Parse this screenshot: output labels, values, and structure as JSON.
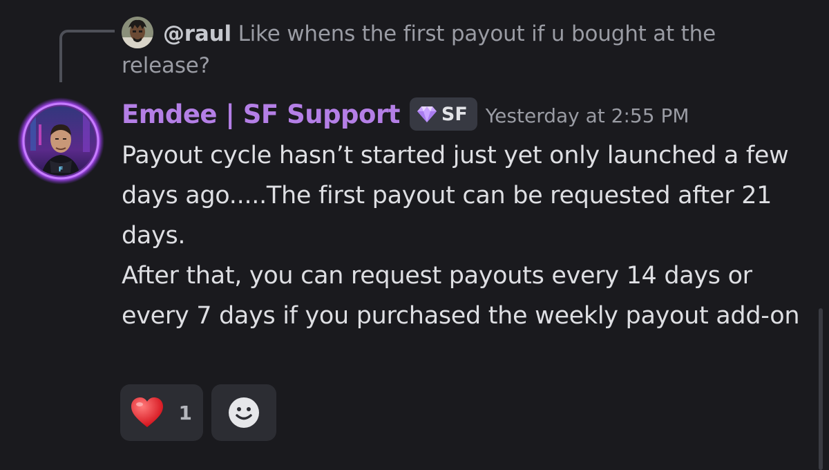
{
  "reply": {
    "username": "@raul",
    "text": "Like whens the first payout if u bought at the release?"
  },
  "message": {
    "author": "Emdee | SF Support",
    "role_tag": "SF",
    "timestamp": "Yesterday at 2:55 PM",
    "paragraphs": [
      "Payout cycle hasn’t started just yet only launched a few days ago.....The first payout can be requested after 21 days.",
      "After that, you can request payouts every 14 days or every 7 days if you purchased the weekly payout add-on"
    ]
  },
  "reactions": [
    {
      "emoji": "heart-icon",
      "count": "1"
    },
    {
      "emoji": "add-reaction-icon"
    }
  ],
  "colors": {
    "background": "#1a1a1e",
    "author": "#b47fe6",
    "text": "#dedfe3",
    "muted": "#9a9ca4",
    "reaction_bg": "#2c2d33"
  }
}
